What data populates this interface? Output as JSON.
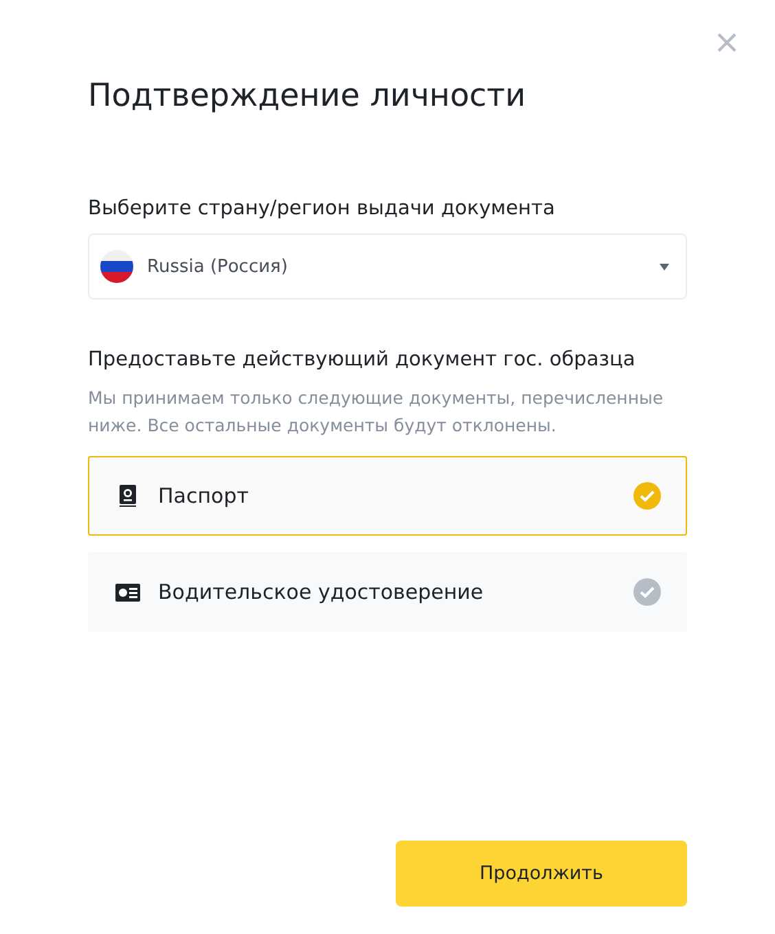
{
  "title": "Подтверждение личности",
  "country": {
    "label": "Выберите страну/регион выдачи документа",
    "value": "Russia (Россия)"
  },
  "documents": {
    "heading": "Предоставьте действующий документ гос. образца",
    "description": "Мы принимаем только следующие документы, перечисленные ниже. Все остальные документы будут отклонены.",
    "items": [
      {
        "kind": "passport",
        "label": "Паспорт",
        "selected": true
      },
      {
        "kind": "license",
        "label": "Водительское удостоверение",
        "selected": false
      }
    ]
  },
  "continue_button": "Продолжить"
}
